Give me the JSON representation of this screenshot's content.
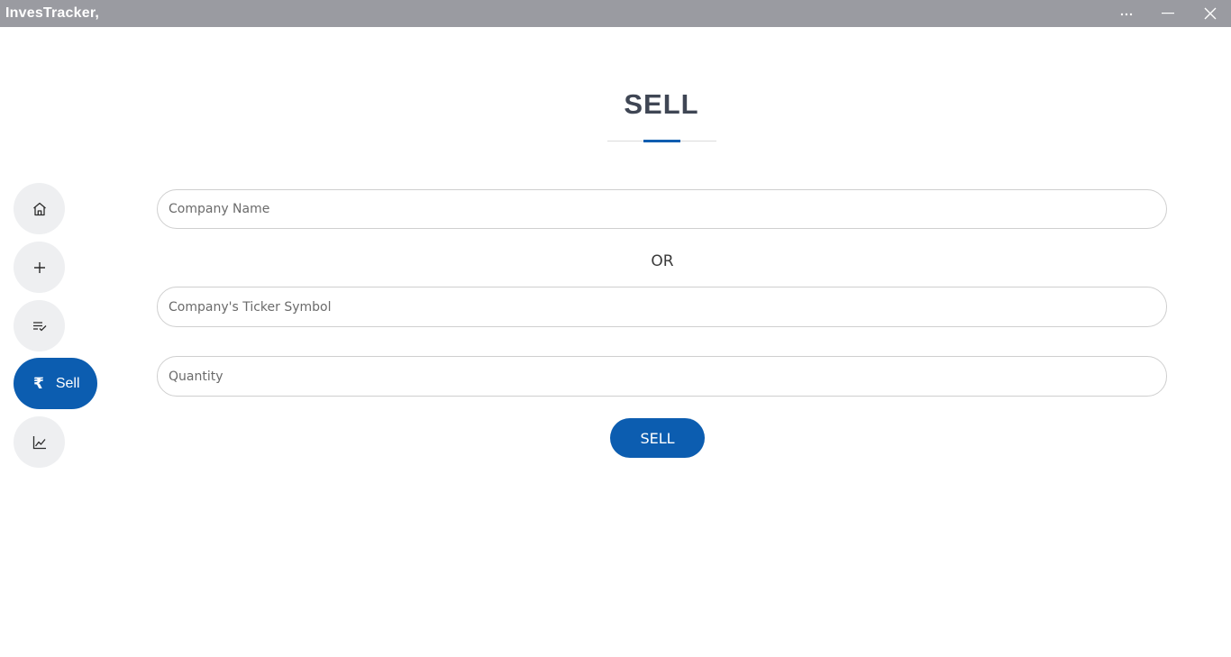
{
  "window": {
    "title": "InvesTracker,",
    "controls": {
      "more_label": "...",
      "minimize_icon": "minimize-icon",
      "close_icon": "close-icon"
    }
  },
  "page": {
    "title": "SELL"
  },
  "sidebar": {
    "items": [
      {
        "name": "home",
        "icon": "home-icon"
      },
      {
        "name": "add",
        "icon": "plus-icon"
      },
      {
        "name": "list",
        "icon": "checklist-icon"
      },
      {
        "name": "sell",
        "icon": "rupee-icon",
        "symbol": "₹",
        "label": "Sell",
        "active": true
      },
      {
        "name": "chart",
        "icon": "line-chart-icon"
      }
    ]
  },
  "form": {
    "company_name": {
      "value": "",
      "placeholder": "Company Name"
    },
    "or_label": "OR",
    "ticker_symbol": {
      "value": "",
      "placeholder": "Company's Ticker Symbol"
    },
    "quantity": {
      "value": "",
      "placeholder": "Quantity"
    },
    "submit_label": "SELL"
  },
  "colors": {
    "accent": "#0c5db0",
    "titlebar": "#9a9ba1",
    "nav_inactive": "#eeeff1",
    "title_text": "#3f4654"
  }
}
